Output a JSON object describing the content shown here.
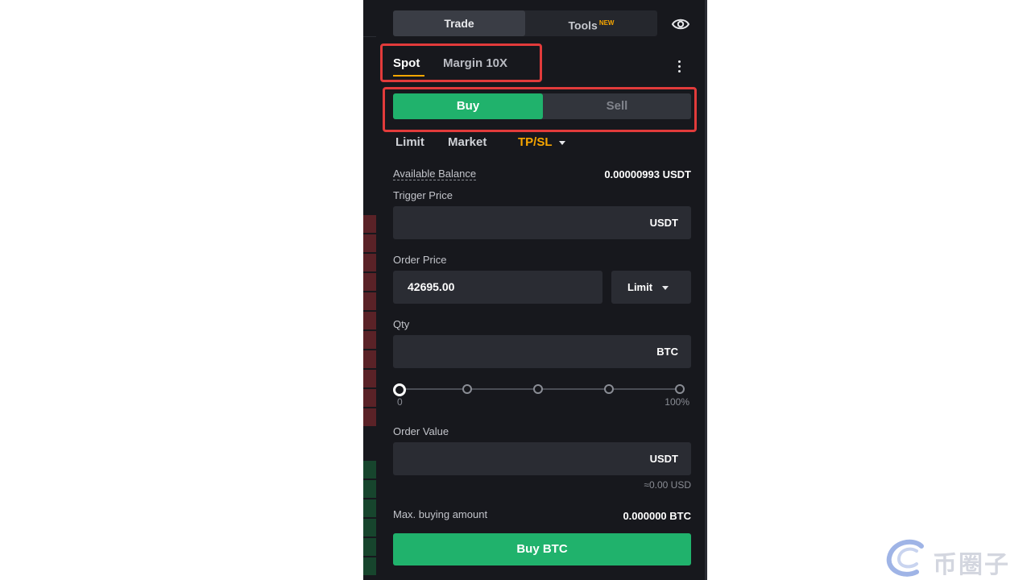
{
  "colors": {
    "panel_bg": "#17181d",
    "accent_orange": "#f7a600",
    "buy_green": "#20b26c",
    "highlight_red": "#e23b3b"
  },
  "top_tabs": {
    "trade": "Trade",
    "tools": "Tools",
    "tools_badge": "NEW"
  },
  "icons": {
    "visibility": "eye-icon",
    "more": "more-vertical-icon",
    "dropdown": "chevron-down-icon"
  },
  "market_tabs": {
    "spot": "Spot",
    "margin": "Margin 10X"
  },
  "side_toggle": {
    "buy": "Buy",
    "sell": "Sell",
    "selected": "Buy"
  },
  "order_types": {
    "limit": "Limit",
    "market": "Market",
    "tpsl": "TP/SL",
    "selected": "TP/SL"
  },
  "available_balance": {
    "label": "Available Balance",
    "value": "0.00000993 USDT"
  },
  "trigger_price": {
    "label": "Trigger Price",
    "value": "",
    "unit": "USDT"
  },
  "order_price": {
    "label": "Order Price",
    "value": "42695.00",
    "type_select": "Limit"
  },
  "qty": {
    "label": "Qty",
    "value": "",
    "unit": "BTC"
  },
  "slider": {
    "min_label": "0",
    "max_label": "100%",
    "percent": 0
  },
  "order_value": {
    "label": "Order Value",
    "value": "",
    "unit": "USDT",
    "approx": "≈0.00 USD"
  },
  "max_buy": {
    "label": "Max. buying amount",
    "value": "0.000000 BTC"
  },
  "submit": {
    "label": "Buy BTC"
  },
  "watermark": {
    "text": "币圈子"
  }
}
